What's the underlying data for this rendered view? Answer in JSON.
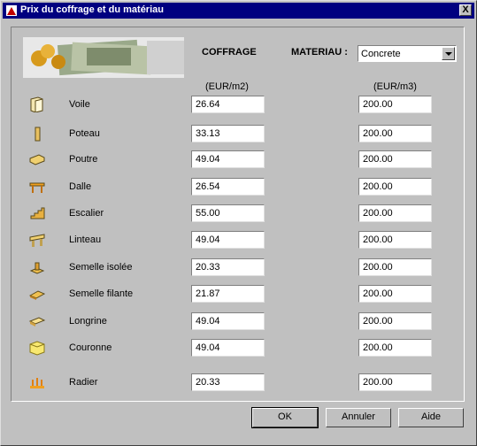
{
  "window": {
    "title": "Prix du coffrage et du matériau",
    "close_label": "X"
  },
  "header": {
    "coffrage_label": "COFFRAGE",
    "materiau_label": "MATERIAU :",
    "materiau_value": "Concrete",
    "unit_coffrage": "(EUR/m2)",
    "unit_materiau": "(EUR/m3)"
  },
  "rows": [
    {
      "label": "Voile",
      "coffrage": "26.64",
      "materiau": "200.00",
      "icon": "wall-icon"
    },
    {
      "label": "Poteau",
      "coffrage": "33.13",
      "materiau": "200.00",
      "icon": "column-icon"
    },
    {
      "label": "Poutre",
      "coffrage": "49.04",
      "materiau": "200.00",
      "icon": "beam-icon"
    },
    {
      "label": "Dalle",
      "coffrage": "26.54",
      "materiau": "200.00",
      "icon": "slab-icon"
    },
    {
      "label": "Escalier",
      "coffrage": "55.00",
      "materiau": "200.00",
      "icon": "stairs-icon"
    },
    {
      "label": "Linteau",
      "coffrage": "49.04",
      "materiau": "200.00",
      "icon": "lintel-icon"
    },
    {
      "label": "Semelle isolée",
      "coffrage": "20.33",
      "materiau": "200.00",
      "icon": "isolated-footing-icon"
    },
    {
      "label": "Semelle filante",
      "coffrage": "21.87",
      "materiau": "200.00",
      "icon": "strip-footing-icon"
    },
    {
      "label": "Longrine",
      "coffrage": "49.04",
      "materiau": "200.00",
      "icon": "ground-beam-icon"
    },
    {
      "label": "Couronne",
      "coffrage": "49.04",
      "materiau": "200.00",
      "icon": "crown-beam-icon"
    },
    {
      "label": "Radier",
      "coffrage": "20.33",
      "materiau": "200.00",
      "icon": "raft-icon"
    }
  ],
  "buttons": {
    "ok": "OK",
    "cancel": "Annuler",
    "help": "Aide"
  }
}
